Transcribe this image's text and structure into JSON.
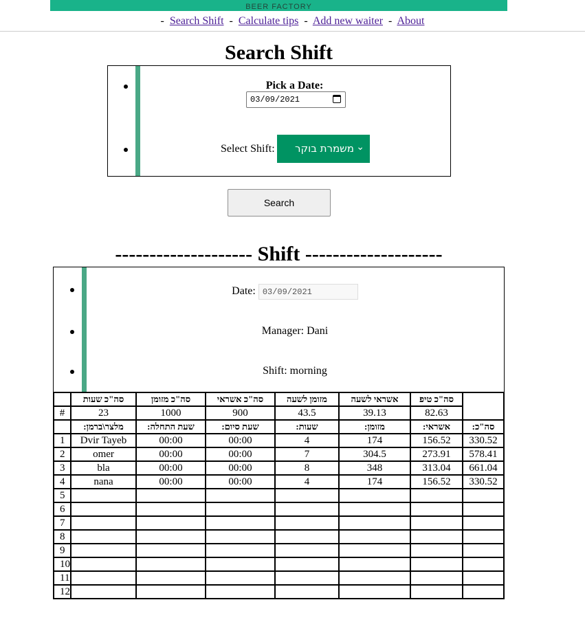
{
  "banner": {
    "text": "BEER FACTORY"
  },
  "nav": {
    "sep": "-",
    "items": [
      "Search Shift",
      "Calculate tips",
      "Add new waiter",
      "About"
    ]
  },
  "search": {
    "title": "Search Shift",
    "pick_label": "Pick a Date:",
    "date_value": "03/09/2021",
    "select_label": "Select Shift:",
    "select_value": "משמרת בוקר",
    "button_label": "Search"
  },
  "shift": {
    "title": "-------------------- Shift --------------------",
    "date_label": "Date:",
    "date_value": "03/09/2021",
    "manager": "Manager: Dani",
    "shift_text": "Shift: morning"
  },
  "summary": {
    "hash": "#",
    "headers": [
      "סה\"כ שעות",
      "סה\"כ מזומן",
      "סה\"כ אשראי",
      "מזומן לשעה",
      "אשראי לשעה",
      "סה\"כ טיפ"
    ],
    "values": [
      "23",
      "1000",
      "900",
      "43.5",
      "39.13",
      "82.63"
    ]
  },
  "waiters": {
    "headers": [
      "מלצר\\ברמן:",
      "שעת התחלה:",
      "שעת סיום:",
      "שעות:",
      "מזומן:",
      "אשראי:",
      "סה\"כ:"
    ],
    "rows": [
      [
        "1",
        "Dvir Tayeb",
        "00:00",
        "00:00",
        "4",
        "174",
        "156.52",
        "330.52"
      ],
      [
        "2",
        "omer",
        "00:00",
        "00:00",
        "7",
        "304.5",
        "273.91",
        "578.41"
      ],
      [
        "3",
        "bla",
        "00:00",
        "00:00",
        "8",
        "348",
        "313.04",
        "661.04"
      ],
      [
        "4",
        "nana",
        "00:00",
        "00:00",
        "4",
        "174",
        "156.52",
        "330.52"
      ],
      [
        "5",
        "",
        "",
        "",
        "",
        "",
        "",
        ""
      ],
      [
        "6",
        "",
        "",
        "",
        "",
        "",
        "",
        ""
      ],
      [
        "7",
        "",
        "",
        "",
        "",
        "",
        "",
        ""
      ],
      [
        "8",
        "",
        "",
        "",
        "",
        "",
        "",
        ""
      ],
      [
        "9",
        "",
        "",
        "",
        "",
        "",
        "",
        ""
      ],
      [
        "10",
        "",
        "",
        "",
        "",
        "",
        "",
        ""
      ],
      [
        "11",
        "",
        "",
        "",
        "",
        "",
        "",
        ""
      ],
      [
        "12",
        "",
        "",
        "",
        "",
        "",
        "",
        ""
      ]
    ]
  }
}
